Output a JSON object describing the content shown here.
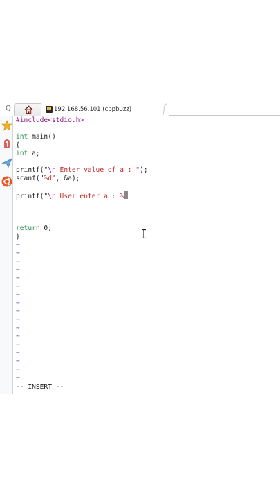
{
  "browser": {
    "tab_title": "192.168.56.101 (cppbuzz)",
    "tab_left_glyph": "Q",
    "home_icon": "home-icon",
    "favicon": "terminal-icon"
  },
  "sidebar": {
    "items": [
      {
        "icon": "star-icon",
        "color": "#f2b01e"
      },
      {
        "icon": "paperclip-icon",
        "color": "#d9534f"
      },
      {
        "icon": "send-icon",
        "color": "#4a90c8"
      },
      {
        "icon": "ubuntu-icon",
        "color": "#e95420"
      }
    ]
  },
  "editor": {
    "include": "#include<stdio.h>",
    "main_kw": "int",
    "main_rest": " main()",
    "open_brace": "{",
    "decl_kw": "int",
    "decl_rest": " a;",
    "printf1_pre": "printf(\"",
    "printf1_esc": "\\n",
    "printf1_str": " Enter value of a : \"",
    "printf1_post": ");",
    "scanf_pre": "scanf(\"",
    "scanf_str": "%d\"",
    "scanf_post": ", &a);",
    "printf2_pre": "printf(\"",
    "printf2_esc": "\\n",
    "printf2_str": " User enter a : %",
    "return_kw": "return",
    "return_rest": " 0;",
    "close_brace": "}",
    "tilde": "~",
    "mode": "-- INSERT --"
  }
}
